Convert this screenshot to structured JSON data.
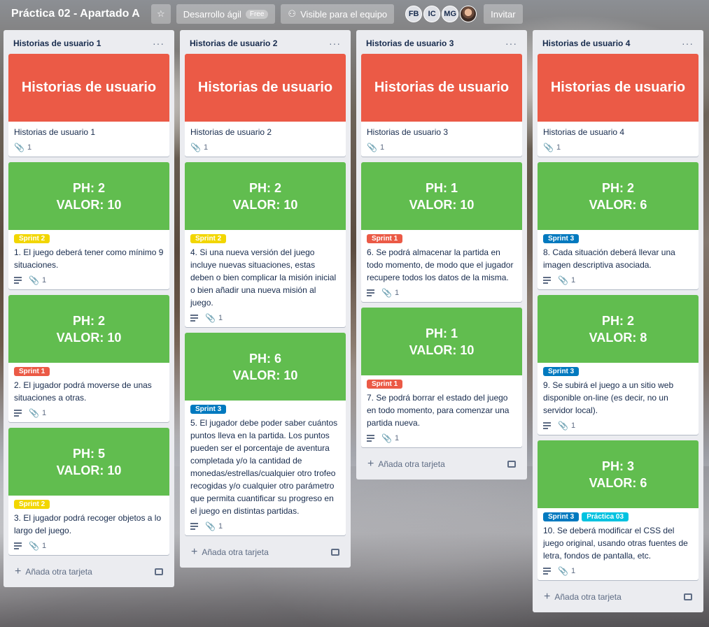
{
  "header": {
    "board_title": "Práctica 02 - Apartado A",
    "workspace": "Desarrollo ágil",
    "workspace_badge": "Free",
    "visibility": "Visible para el equipo",
    "members": [
      "FB",
      "IC",
      "MG"
    ],
    "invite": "Invitar"
  },
  "colors": {
    "red": "#eb5a46",
    "green": "#61bd4f",
    "yellow": "#f2d600",
    "blue": "#0079bf",
    "sky": "#00c2e0"
  },
  "add_card_label": "Añada otra tarjeta",
  "lists": [
    {
      "title": "Historias de usuario 1",
      "cards": [
        {
          "cover": "red",
          "cover_text": "Historias de usuario",
          "title": "Historias de usuario 1",
          "attachments": "1"
        },
        {
          "cover": "green",
          "ph": "PH: 2",
          "valor": "VALOR: 10",
          "labels": [
            {
              "text": "Sprint 2",
              "color": "yellow"
            }
          ],
          "title": "1. El juego deberá tener como mínimo 9 situaciones.",
          "attachments": "1"
        },
        {
          "cover": "green",
          "ph": "PH: 2",
          "valor": "VALOR: 10",
          "labels": [
            {
              "text": "Sprint 1",
              "color": "red"
            }
          ],
          "title": "2. El jugador podrá moverse de unas situaciones a otras.",
          "attachments": "1"
        },
        {
          "cover": "green",
          "ph": "PH: 5",
          "valor": "VALOR: 10",
          "labels": [
            {
              "text": "Sprint 2",
              "color": "yellow"
            }
          ],
          "title": "3. El jugador podrá recoger objetos a lo largo del juego.",
          "attachments": "1"
        }
      ]
    },
    {
      "title": "Historias de usuario 2",
      "cards": [
        {
          "cover": "red",
          "cover_text": "Historias de usuario",
          "title": "Historias de usuario 2",
          "attachments": "1"
        },
        {
          "cover": "green",
          "ph": "PH: 2",
          "valor": "VALOR: 10",
          "labels": [
            {
              "text": "Sprint 2",
              "color": "yellow"
            }
          ],
          "title": "4. Si una nueva versión del juego incluye nuevas situaciones, estas deben o bien complicar la misión inicial o bien añadir una nueva misión al juego.",
          "attachments": "1"
        },
        {
          "cover": "green",
          "ph": "PH: 6",
          "valor": "VALOR: 10",
          "labels": [
            {
              "text": "Sprint 3",
              "color": "blue"
            }
          ],
          "title": "5. El jugador debe poder saber cuántos puntos lleva en la partida. Los puntos pueden ser el porcentaje de aventura completada y/o la cantidad de monedas/estrellas/cualquier otro trofeo recogidas y/o cualquier otro parámetro que permita cuantificar su progreso en el juego en distintas partidas.",
          "attachments": "1"
        }
      ]
    },
    {
      "title": "Historias de usuario 3",
      "cards": [
        {
          "cover": "red",
          "cover_text": "Historias de usuario",
          "title": "Historias de usuario 3",
          "attachments": "1"
        },
        {
          "cover": "green",
          "ph": "PH: 1",
          "valor": "VALOR: 10",
          "labels": [
            {
              "text": "Sprint 1",
              "color": "red"
            }
          ],
          "title": "6. Se podrá almacenar la partida en todo momento, de modo que el jugador recupere todos los datos de la misma.",
          "attachments": "1"
        },
        {
          "cover": "green",
          "ph": "PH: 1",
          "valor": "VALOR: 10",
          "labels": [
            {
              "text": "Sprint 1",
              "color": "red"
            }
          ],
          "title": "7. Se podrá borrar el estado del juego en todo momento, para comenzar una partida nueva.",
          "attachments": "1"
        }
      ]
    },
    {
      "title": "Historias de usuario 4",
      "cards": [
        {
          "cover": "red",
          "cover_text": "Historias de usuario",
          "title": "Historias de usuario 4",
          "attachments": "1"
        },
        {
          "cover": "green",
          "ph": "PH: 2",
          "valor": "VALOR: 6",
          "labels": [
            {
              "text": "Sprint 3",
              "color": "blue"
            }
          ],
          "title": "8. Cada situación deberá llevar una imagen descriptiva asociada.",
          "attachments": "1"
        },
        {
          "cover": "green",
          "ph": "PH: 2",
          "valor": "VALOR: 8",
          "labels": [
            {
              "text": "Sprint 3",
              "color": "blue"
            }
          ],
          "title": "9. Se subirá el juego a un sitio web disponible on-line (es decir, no un servidor local).",
          "attachments": "1"
        },
        {
          "cover": "green",
          "ph": "PH: 3",
          "valor": "VALOR: 6",
          "labels": [
            {
              "text": "Sprint 3",
              "color": "blue"
            },
            {
              "text": "Práctica 03",
              "color": "sky"
            }
          ],
          "title": "10. Se deberá modificar el CSS del juego original, usando otras fuentes de letra, fondos de pantalla, etc.",
          "attachments": "1"
        }
      ]
    }
  ]
}
